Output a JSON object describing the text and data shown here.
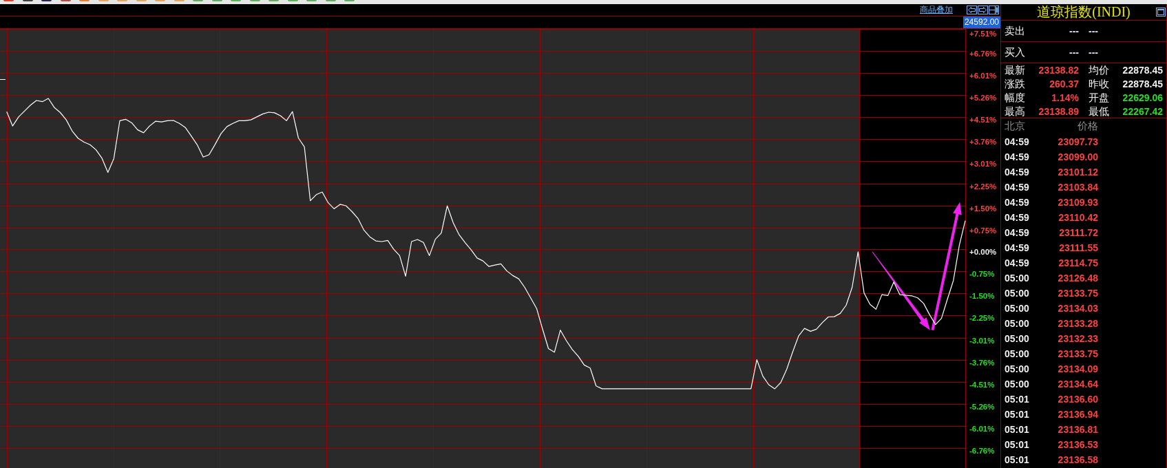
{
  "toolbar": {
    "icons": [
      {
        "color": "#e04030"
      },
      {
        "color": "#404040"
      },
      {
        "color": "#302050"
      },
      {
        "color": "#b05040"
      },
      {
        "color": "#e08030"
      },
      {
        "color": "#e0a860"
      },
      {
        "color": "#e0a860"
      },
      {
        "color": "#e0a860"
      },
      {
        "color": "#e0a860"
      },
      {
        "color": "#e0a860"
      },
      {
        "color": "#60b060"
      },
      {
        "color": "#60b060"
      },
      {
        "color": "#60b060"
      },
      {
        "color": "#60b060"
      },
      {
        "color": "#60b060"
      },
      {
        "color": "#60b060"
      },
      {
        "color": "#60b060"
      },
      {
        "color": "#60b060"
      },
      {
        "color": "#60b060"
      }
    ]
  },
  "chart_header": {
    "overlay_link": "商品叠加",
    "price_label": "24592.00"
  },
  "chart": {
    "chart_data": {
      "type": "line",
      "grid": true,
      "categories": [
        null,
        null,
        null,
        null,
        null,
        null,
        null,
        null,
        null,
        null,
        null,
        null,
        null,
        null,
        null,
        null,
        null,
        null,
        null,
        null,
        null,
        null,
        null,
        null,
        null,
        null,
        null,
        null,
        null,
        null,
        null,
        null,
        null,
        null,
        null,
        null,
        null,
        null,
        null,
        null,
        null,
        null,
        null,
        null,
        null,
        null,
        null,
        null,
        null,
        null,
        null,
        null,
        null,
        null,
        null,
        null,
        null,
        null,
        null,
        null,
        null,
        null,
        null,
        null,
        null,
        null,
        null,
        null,
        null,
        null,
        null,
        null,
        null,
        null,
        null,
        null,
        null,
        null,
        null,
        null,
        null,
        null,
        null,
        null,
        null,
        null,
        null,
        null,
        null,
        null,
        null,
        null,
        null,
        null,
        null,
        null,
        null,
        null,
        null,
        null,
        null,
        null,
        null,
        null,
        null,
        null,
        null,
        null,
        null,
        null,
        null,
        null,
        null,
        null,
        null,
        null,
        null,
        null,
        null,
        null,
        null,
        null,
        null,
        null,
        null,
        null,
        null,
        null,
        null,
        null,
        null,
        null,
        null,
        null,
        null,
        null,
        null,
        null,
        null,
        null,
        null,
        null,
        null,
        null,
        null,
        null,
        null,
        null,
        null,
        null,
        null,
        null,
        null,
        null,
        null,
        null,
        null,
        null,
        null,
        null,
        null,
        null
      ],
      "ylim": [
        -7.45,
        7.52
      ],
      "yticks": [
        {
          "value": 7.51,
          "label": "+7.51%"
        },
        {
          "value": 6.76,
          "label": "+6.76%"
        },
        {
          "value": 6.01,
          "label": "+6.01%"
        },
        {
          "value": 5.26,
          "label": "+5.26%"
        },
        {
          "value": 4.51,
          "label": "+4.51%"
        },
        {
          "value": 3.76,
          "label": "+3.76%"
        },
        {
          "value": 3.01,
          "label": "+3.01%"
        },
        {
          "value": 2.25,
          "label": "+2.25%"
        },
        {
          "value": 1.5,
          "label": "+1.50%"
        },
        {
          "value": 0.75,
          "label": "+0.75%"
        },
        {
          "value": 0,
          "label": "+0.00%"
        },
        {
          "value": -0.75,
          "label": "-0.75%"
        },
        {
          "value": -1.5,
          "label": "-1.50%"
        },
        {
          "value": -2.25,
          "label": "-2.25%"
        },
        {
          "value": -3.01,
          "label": "-3.01%"
        },
        {
          "value": -3.76,
          "label": "-3.76%"
        },
        {
          "value": -4.51,
          "label": "-4.51%"
        },
        {
          "value": -5.26,
          "label": "-5.26%"
        },
        {
          "value": -6.01,
          "label": "-6.01%"
        },
        {
          "value": -6.76,
          "label": "-6.76%"
        }
      ],
      "values": [
        4.7,
        4.21,
        4.52,
        4.72,
        4.92,
        5.08,
        5.04,
        5.15,
        4.84,
        4.67,
        4.42,
        4.04,
        3.79,
        3.66,
        3.57,
        3.4,
        3.11,
        2.63,
        3.1,
        4.39,
        4.44,
        4.32,
        4.08,
        3.98,
        4.21,
        4.37,
        4.35,
        4.39,
        4.4,
        4.3,
        4.16,
        3.87,
        3.57,
        3.15,
        3.23,
        3.58,
        3.95,
        4.19,
        4.3,
        4.39,
        4.39,
        4.42,
        4.52,
        4.62,
        4.68,
        4.66,
        4.56,
        4.39,
        4.7,
        3.8,
        3.5,
        1.66,
        1.87,
        1.96,
        1.59,
        1.39,
        1.54,
        1.49,
        1.29,
        1.06,
        0.66,
        0.43,
        0.29,
        0.27,
        0.31,
        0.01,
        -0.21,
        -0.91,
        0.27,
        0.34,
        0.24,
        -0.21,
        0.35,
        0.56,
        1.49,
        0.91,
        0.5,
        0.23,
        -0.01,
        -0.29,
        -0.39,
        -0.58,
        -0.53,
        -0.49,
        -0.73,
        -0.89,
        -1.0,
        -1.29,
        -1.65,
        -2.01,
        -2.71,
        -3.38,
        -3.5,
        -2.75,
        -3.11,
        -3.41,
        -3.64,
        -3.94,
        -4.04,
        -4.65,
        -4.75,
        -4.75,
        -4.75,
        -4.75,
        -4.75,
        -4.75,
        -4.75,
        -4.75,
        -4.75,
        -4.75,
        -4.75,
        -4.75,
        -4.75,
        -4.75,
        -4.75,
        -4.75,
        -4.75,
        -4.75,
        -4.75,
        -4.75,
        -4.75,
        -4.75,
        -4.75,
        -4.75,
        -4.75,
        -4.75,
        -3.76,
        -4.32,
        -4.61,
        -4.75,
        -4.54,
        -4.09,
        -3.5,
        -2.95,
        -2.69,
        -2.79,
        -2.72,
        -2.49,
        -2.3,
        -2.29,
        -2.18,
        -1.9,
        -1.29,
        -0.08,
        -1.48,
        -1.87,
        -2.04,
        -1.54,
        -1.57,
        -1.11,
        -1.54,
        -1.56,
        -1.58,
        -1.65,
        -1.84,
        -2.22,
        -2.56,
        -2.35,
        -1.69,
        -1.06,
        0.15,
        0.98
      ]
    }
  },
  "quote_panel": {
    "title": "道琼指数(INDI)",
    "order_rows": [
      {
        "label": "卖出",
        "values": [
          "---",
          "---"
        ]
      },
      {
        "label": "买入",
        "values": [
          "---",
          "---"
        ]
      }
    ],
    "stats": [
      {
        "label": "最新",
        "value": "23138.82",
        "color": "#ff4040"
      },
      {
        "label": "均价",
        "value": "22878.45",
        "color": "#f0f0f0"
      },
      {
        "label": "涨跌",
        "value": "260.37",
        "color": "#ff4040"
      },
      {
        "label": "昨收",
        "value": "22878.45",
        "color": "#f0f0f0"
      },
      {
        "label": "幅度",
        "value": "1.14%",
        "color": "#ff4040"
      },
      {
        "label": "开盘",
        "value": "22629.06",
        "color": "#20e020"
      },
      {
        "label": "最高",
        "value": "23138.89",
        "color": "#ff4040"
      },
      {
        "label": "最低",
        "value": "22267.42",
        "color": "#20e020"
      }
    ],
    "ticks_header": [
      "北京",
      "价格"
    ],
    "ticks": [
      {
        "time": "04:59",
        "price": "23097.73"
      },
      {
        "time": "04:59",
        "price": "23099.00"
      },
      {
        "time": "04:59",
        "price": "23101.12"
      },
      {
        "time": "04:59",
        "price": "23103.84"
      },
      {
        "time": "04:59",
        "price": "23109.93"
      },
      {
        "time": "04:59",
        "price": "23110.42"
      },
      {
        "time": "04:59",
        "price": "23111.72"
      },
      {
        "time": "04:59",
        "price": "23111.55"
      },
      {
        "time": "04:59",
        "price": "23114.75"
      },
      {
        "time": "05:00",
        "price": "23126.48"
      },
      {
        "time": "05:00",
        "price": "23133.75"
      },
      {
        "time": "05:00",
        "price": "23134.03"
      },
      {
        "time": "05:00",
        "price": "23133.28"
      },
      {
        "time": "05:00",
        "price": "23132.33"
      },
      {
        "time": "05:00",
        "price": "23133.75"
      },
      {
        "time": "05:00",
        "price": "23134.09"
      },
      {
        "time": "05:00",
        "price": "23134.64"
      },
      {
        "time": "05:01",
        "price": "23136.60"
      },
      {
        "time": "05:01",
        "price": "23136.94"
      },
      {
        "time": "05:01",
        "price": "23136.81"
      },
      {
        "time": "05:01",
        "price": "23136.53"
      },
      {
        "time": "05:01",
        "price": "23136.58"
      }
    ]
  }
}
